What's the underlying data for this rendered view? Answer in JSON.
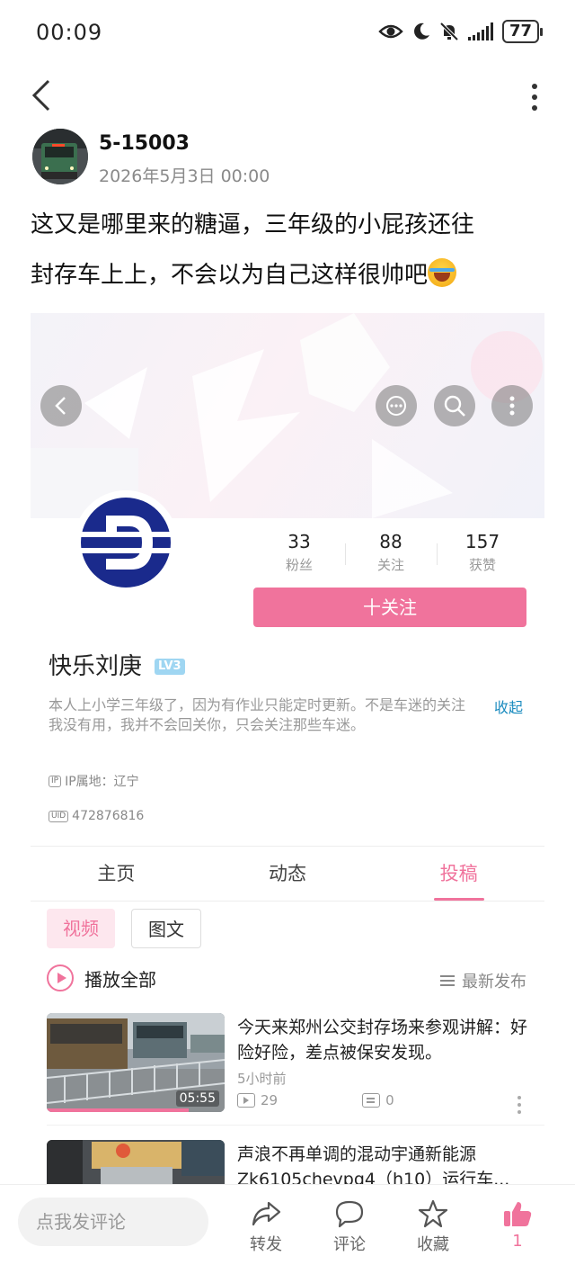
{
  "status": {
    "time": "00:09",
    "battery": "77"
  },
  "post": {
    "author_name": "5-15003",
    "date": "2026年5月3日 00:00",
    "text_line1": "这又是哪里来的糖逼，三年级的小屁孩还往",
    "text_line2": "封存车上上，不会以为自己这样很帅吧"
  },
  "profile": {
    "stats": [
      {
        "value": "33",
        "label": "粉丝"
      },
      {
        "value": "88",
        "label": "关注"
      },
      {
        "value": "157",
        "label": "获赞"
      }
    ],
    "follow_label": "十关注",
    "nickname": "快乐刘庚",
    "level": "LV3",
    "bio": "本人上小学三年级了，因为有作业只能定时更新。不是车迷的关注我没有用，我并不会回关你，只会关注那些车迷。",
    "collapse_label": "收起",
    "ip_label": "IP属地：辽宁",
    "uid": "472876816",
    "tabs": [
      "主页",
      "动态",
      "投稿"
    ],
    "active_tab": 2,
    "subtabs": [
      "视频",
      "图文"
    ],
    "play_all": "播放全部",
    "sort_label": "最新发布",
    "videos": [
      {
        "title": "今天来郑州公交封存场来参观讲解：好险好险，差点被保安发现。",
        "duration": "05:55",
        "time": "5小时前",
        "plays": "29",
        "comments": "0",
        "progress": 0.8
      },
      {
        "title": "声浪不再单调的混动宇通新能源Zk6105chevpg4（h10）运行车...",
        "duration": "",
        "time": "",
        "plays": "",
        "comments": "",
        "progress": 0
      }
    ]
  },
  "bottom_bar": {
    "comment_placeholder": "点我发评论",
    "actions": [
      {
        "label": "转发",
        "icon": "share-icon"
      },
      {
        "label": "评论",
        "icon": "comment-icon"
      },
      {
        "label": "收藏",
        "icon": "star-icon"
      },
      {
        "label": "1",
        "icon": "thumbs-up-icon"
      }
    ]
  },
  "colors": {
    "accent": "#f0739c",
    "link": "#1a8bbf",
    "logo_blue": "#1a2a8c"
  }
}
